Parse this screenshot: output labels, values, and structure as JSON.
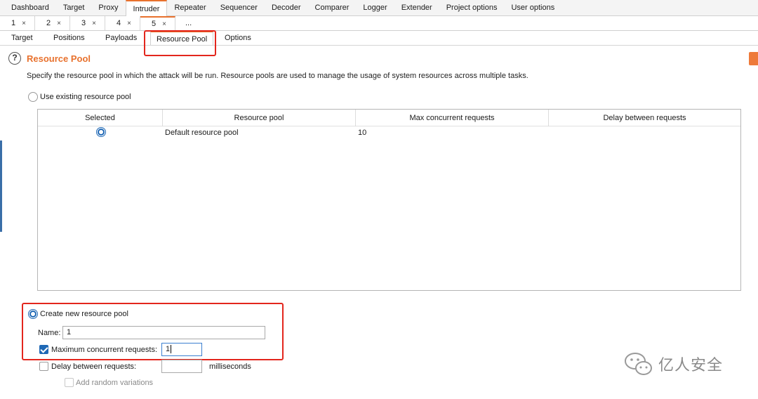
{
  "top_tabs": [
    "Dashboard",
    "Target",
    "Proxy",
    "Intruder",
    "Repeater",
    "Sequencer",
    "Decoder",
    "Comparer",
    "Logger",
    "Extender",
    "Project options",
    "User options"
  ],
  "number_tabs": [
    "1",
    "2",
    "3",
    "4",
    "5"
  ],
  "number_tabs_more": "...",
  "close_glyph": "×",
  "sub_tabs": [
    "Target",
    "Positions",
    "Payloads",
    "Resource Pool",
    "Options"
  ],
  "help_icon": "?",
  "section": {
    "title": "Resource Pool",
    "description": "Specify the resource pool in which the attack will be run. Resource pools are used to manage the usage of system resources across multiple tasks."
  },
  "use_existing_label": "Use existing resource pool",
  "table": {
    "columns": [
      "Selected",
      "Resource pool",
      "Max concurrent requests",
      "Delay between requests"
    ],
    "rows": [
      {
        "resource_pool": "Default resource pool",
        "max_concurrent": "10",
        "delay": ""
      }
    ]
  },
  "create_new_label": "Create new resource pool",
  "name_label": "Name:",
  "name_value": "1",
  "max_concurrent_label": "Maximum concurrent requests:",
  "max_concurrent_value": "1",
  "delay_label": "Delay between requests:",
  "delay_value": "",
  "delay_unit": "milliseconds",
  "random_variations_label": "Add random variations",
  "watermark_text": "亿人安全",
  "colors": {
    "accent": "#e8712d",
    "highlight": "#e3261d",
    "selection": "#1f68b5"
  }
}
